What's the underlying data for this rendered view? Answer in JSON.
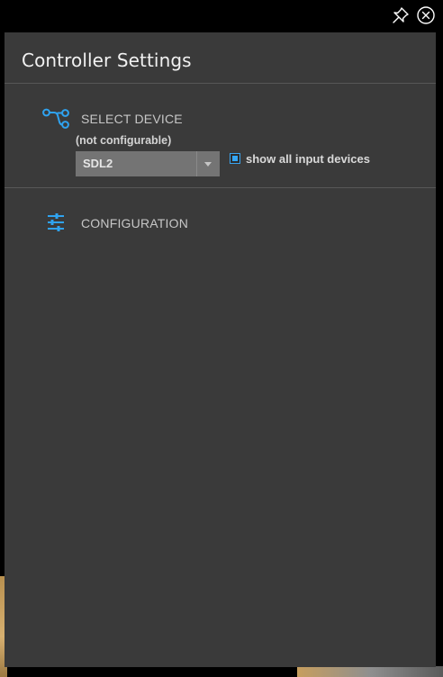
{
  "window": {
    "title": "Controller Settings",
    "pin_icon": "pin-icon",
    "close_icon": "close-icon"
  },
  "select_device": {
    "heading": "SELECT DEVICE",
    "icon": "device-link-icon",
    "note": "(not configurable)",
    "selected": "SDL2",
    "show_all_label": "show all input devices",
    "show_all_checked": true
  },
  "configuration": {
    "heading": "CONFIGURATION",
    "icon": "sliders-icon"
  },
  "colors": {
    "accent": "#34a6f4",
    "panel_bg": "#3a3a3a",
    "window_bg": "#000000"
  }
}
